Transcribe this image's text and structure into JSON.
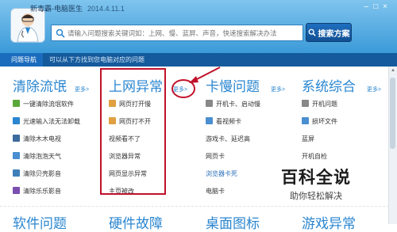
{
  "app": {
    "title": "新毒霸-电脑医生",
    "version": "2014.4.11.1"
  },
  "search": {
    "placeholder": "请输入问题搜索关键词如：上网、慢、蓝屏、声音，快速搜索解决办法",
    "button": "搜索方案"
  },
  "nav": {
    "active": "问题导航",
    "hint": "可以从下方找到您电脑对应的问题"
  },
  "more_label": "更多>",
  "columns": [
    {
      "title": "清除流氓",
      "items": [
        "一键清除流氓软件",
        "光速输入法无法卸载",
        "清除木木电视",
        "清除泡泡天气",
        "清除贝壳影音",
        "清除乐乐影音"
      ]
    },
    {
      "title": "上网异常",
      "items": [
        "网页打开慢",
        "网页打不开",
        "视频看不了",
        "浏览器异常",
        "网页显示异常",
        "主页被改"
      ]
    },
    {
      "title": "卡慢问题",
      "items": [
        "开机卡、启动慢",
        "看视频卡",
        "游戏卡、延迟高",
        "网页卡",
        "浏览器卡死",
        "电脑卡"
      ]
    },
    {
      "title": "系统综合",
      "items": [
        "开机问题",
        "损坏文件",
        "蓝屏",
        "开机自检"
      ]
    }
  ],
  "bottom_titles": [
    "软件问题",
    "硬件故障",
    "桌面图标",
    "游戏异常"
  ],
  "watermark": {
    "title": "百科全说",
    "subtitle": "助你轻松解决"
  },
  "colors": {
    "header": "#3b9ad8",
    "navbar": "#145a9c",
    "accent": "#2a86d0",
    "annotation": "#c0122b"
  }
}
